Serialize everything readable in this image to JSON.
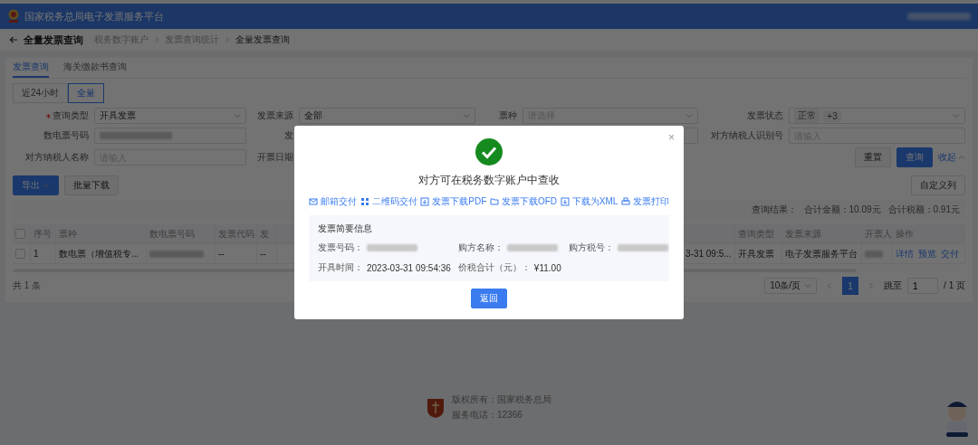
{
  "header": {
    "title": "国家税务总局电子发票服务平台"
  },
  "page": {
    "title": "全量发票查询",
    "breadcrumb": [
      "税务数字账户",
      "发票查询统计",
      "全量发票查询"
    ]
  },
  "tabs": [
    {
      "label": "发票查询",
      "selected": true
    },
    {
      "label": "海关缴款书查询",
      "selected": false
    }
  ],
  "time_range": [
    {
      "label": "近24小时",
      "selected": false
    },
    {
      "label": "全量",
      "selected": true
    }
  ],
  "filters": [
    {
      "kind": "select",
      "label": "查询类型",
      "required": true,
      "value": "开具发票"
    },
    {
      "kind": "select",
      "label": "发票来源",
      "required": false,
      "value": "全部"
    },
    {
      "kind": "select",
      "label": "票种",
      "required": false,
      "placeholder": "请选择"
    },
    {
      "kind": "tags",
      "label": "发票状态",
      "required": false,
      "tags": [
        "正常",
        "+3"
      ]
    },
    {
      "kind": "redacted",
      "label": "数电票号码",
      "required": false
    },
    {
      "kind": "text",
      "label": "发",
      "required": false
    },
    {
      "kind": "text"
    },
    {
      "kind": "text",
      "label": "对方纳税人识别号",
      "required": false,
      "placeholder": "请输入"
    },
    {
      "kind": "text",
      "label": "对方纳税人名称",
      "required": false,
      "placeholder": "请输入"
    },
    {
      "kind": "text",
      "label": "开票日期",
      "required": false
    }
  ],
  "filter_buttons": [
    {
      "label": "重置",
      "kind": "default"
    },
    {
      "label": "查询",
      "kind": "primary"
    }
  ],
  "collapse_link": "收起",
  "toolbar": {
    "export": "导出",
    "batch_download": "批量下载",
    "custom_columns": "自定义列"
  },
  "summary": [
    "查询结果：",
    "合计金额：10.09元",
    "合计税额：0.91元"
  ],
  "table": {
    "columns": [
      {
        "kind": "checkbox",
        "checked": false
      },
      {
        "kind": "text",
        "label": "序号"
      },
      {
        "kind": "text",
        "label": "票种"
      },
      {
        "kind": "text",
        "label": "数电票号码"
      },
      {
        "kind": "text",
        "label": "发票代码"
      },
      {
        "kind": "text",
        "label": "发"
      },
      {
        "kind": "covered"
      },
      {
        "kind": "text"
      },
      {
        "kind": "text",
        "label": "查询类型"
      },
      {
        "kind": "text",
        "label": "发票来源"
      },
      {
        "kind": "text",
        "label": "开票人"
      },
      {
        "kind": "text",
        "label": "操作"
      }
    ],
    "rows": [
      {
        "cells": [
          {
            "kind": "checkbox",
            "checked": false
          },
          {
            "kind": "text",
            "text": "1"
          },
          {
            "kind": "text",
            "text": "数电票（增值税专..."
          },
          {
            "kind": "redacted"
          },
          {
            "kind": "text",
            "text": "--"
          },
          {
            "kind": "text",
            "text": "--"
          },
          {
            "kind": "covered"
          },
          {
            "kind": "text",
            "text": "3-31 09:5..."
          },
          {
            "kind": "text",
            "text": "开具发票"
          },
          {
            "kind": "text",
            "text": "电子发票服务平台"
          },
          {
            "kind": "redacted"
          },
          {
            "kind": "links",
            "links": [
              "详情",
              "预览",
              "交付"
            ]
          }
        ]
      }
    ]
  },
  "total": "共 1 条",
  "pagination": {
    "page_size": "10条/页",
    "pages": [
      {
        "label": "1",
        "selected": true
      }
    ],
    "jump_label": "跳至",
    "jump_value": "1",
    "total_pages": "/ 1 页"
  },
  "footer": {
    "lines": [
      "版权所有：国家税务总局",
      "服务电话：12366"
    ]
  },
  "modal": {
    "close": "×",
    "title": "对方可在税务数字账户中查收",
    "actions": [
      {
        "kind": "mail",
        "label": "邮箱交付"
      },
      {
        "kind": "qr",
        "label": "二维码交付"
      },
      {
        "kind": "download",
        "label": "发票下载PDF"
      },
      {
        "kind": "folder",
        "label": "发票下载OFD"
      },
      {
        "kind": "download",
        "label": "下载为XML"
      },
      {
        "kind": "print",
        "label": "发票打印"
      }
    ],
    "info": {
      "title": "发票简要信息",
      "fields": [
        {
          "kind": "redacted",
          "label": "发票号码："
        },
        {
          "kind": "redacted",
          "label": "购方名称："
        },
        {
          "kind": "redacted",
          "label": "购方税号："
        },
        {
          "kind": "text",
          "label": "开具时间：",
          "value": "2023-03-31 09:54:36"
        },
        {
          "kind": "text",
          "label": "价税合计（元）：",
          "value": "¥11.00"
        }
      ]
    },
    "button": "返回"
  }
}
